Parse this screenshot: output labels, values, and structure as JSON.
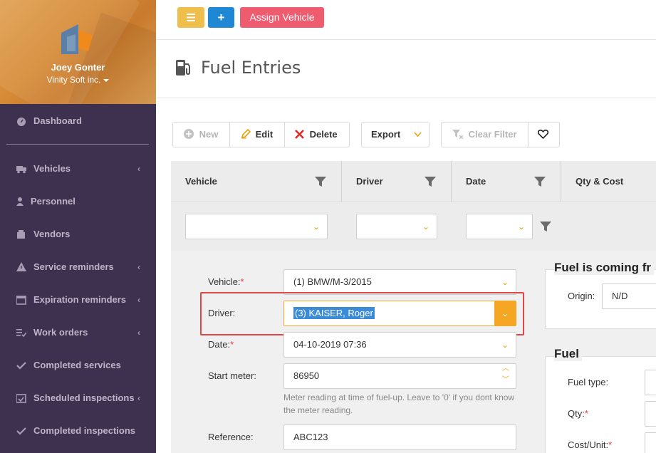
{
  "profile": {
    "user_name": "Joey Gonter",
    "company": "Vinity Soft inc."
  },
  "sidebar": {
    "items": [
      {
        "label": "Dashboard",
        "icon": "dashboard-icon",
        "has_submenu": false
      },
      {
        "label": "Vehicles",
        "icon": "truck-icon",
        "has_submenu": true
      },
      {
        "label": "Personnel",
        "icon": "user-icon",
        "has_submenu": false
      },
      {
        "label": "Vendors",
        "icon": "building-icon",
        "has_submenu": false
      },
      {
        "label": "Service reminders",
        "icon": "warning-icon",
        "has_submenu": true
      },
      {
        "label": "Expiration reminders",
        "icon": "calendar-icon",
        "has_submenu": true
      },
      {
        "label": "Work orders",
        "icon": "list-check-icon",
        "has_submenu": true
      },
      {
        "label": "Completed services",
        "icon": "check-icon",
        "has_submenu": false
      },
      {
        "label": "Scheduled inspections",
        "icon": "calendar-check-icon",
        "has_submenu": true
      },
      {
        "label": "Completed inspections",
        "icon": "check-icon",
        "has_submenu": false
      }
    ]
  },
  "topbar": {
    "assign_label": "Assign Vehicle",
    "plus_label": "+"
  },
  "page": {
    "title": "Fuel Entries"
  },
  "toolbar": {
    "new_label": "New",
    "edit_label": "Edit",
    "delete_label": "Delete",
    "export_label": "Export",
    "clear_filter_label": "Clear Filter"
  },
  "grid": {
    "columns": [
      "Vehicle",
      "Driver",
      "Date",
      "Qty & Cost"
    ]
  },
  "form": {
    "vehicle_label": "Vehicle:",
    "vehicle_value": "(1) BMW/M-3/2015",
    "driver_label": "Driver:",
    "driver_value": "(3) KAISER, Roger",
    "date_label": "Date:",
    "date_value": "04-10-2019 07:36",
    "start_meter_label": "Start meter:",
    "start_meter_value": "86950",
    "start_meter_hint": "Meter reading at time of fuel-up. Leave to '0' if you dont know the meter reading.",
    "reference_label": "Reference:",
    "reference_value": "ABC123",
    "required_mark": "*"
  },
  "panel_origin": {
    "title": "Fuel is coming fr",
    "origin_label": "Origin:",
    "origin_value": "N/D"
  },
  "panel_fuel": {
    "title": "Fuel",
    "fuel_type_label": "Fuel type:",
    "qty_label": "Qty:",
    "cost_unit_label": "Cost/Unit:",
    "required_mark": "*"
  },
  "colors": {
    "sidebar": "#3e3150",
    "accent_orange": "#f5a623",
    "assign_red": "#ef5b6f",
    "plus_blue": "#1f88d4",
    "menu_yellow": "#f0be4a"
  }
}
